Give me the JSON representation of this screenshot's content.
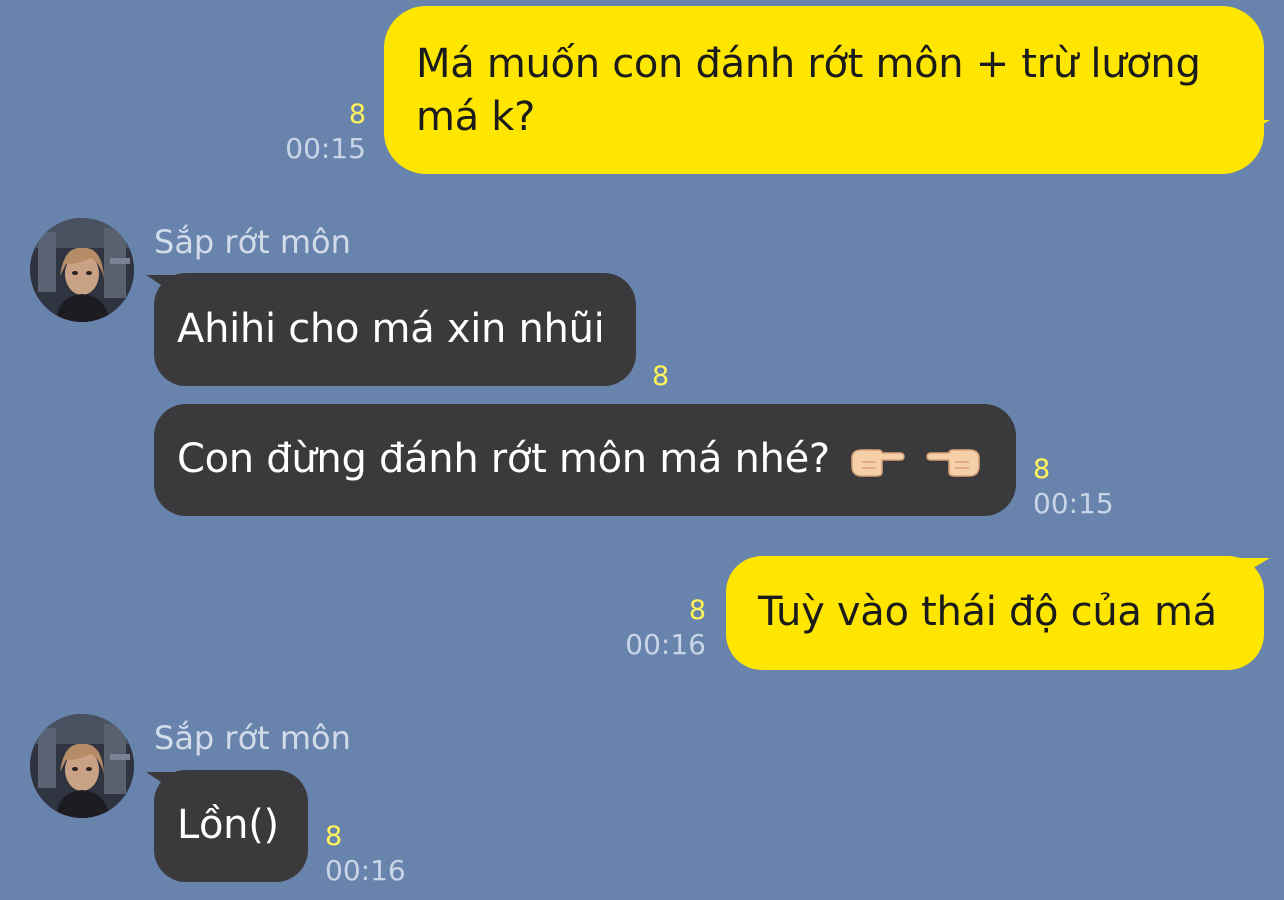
{
  "theme": {
    "background": "#6884ad",
    "sent_bubble": "#ffe600",
    "received_bubble": "#3a3a3d",
    "read_count_color": "#fff35a",
    "time_color": "#c9d4e6",
    "sender_color": "#d2dbea"
  },
  "messages": [
    {
      "direction": "sent",
      "text_line1": "Má muốn con đánh rớt môn + trừ lương",
      "text_line2": "má k?",
      "read_count": "8",
      "time": "00:15"
    },
    {
      "direction": "received",
      "sender": "Sắp rớt môn",
      "avatar_icon": "profile-photo-icon",
      "text": "Ahihi cho má xin nhũi",
      "read_count": "8"
    },
    {
      "direction": "received",
      "text": "Con đừng đánh rớt môn má nhé?",
      "emoji_icons": [
        "pointing-right-hand-icon",
        "pointing-left-hand-icon"
      ],
      "read_count": "8",
      "time": "00:15"
    },
    {
      "direction": "sent",
      "text": "Tuỳ vào thái độ của má",
      "read_count": "8",
      "time": "00:16"
    },
    {
      "direction": "received",
      "sender": "Sắp rớt môn",
      "avatar_icon": "profile-photo-icon",
      "text": "Lồn()",
      "read_count": "8",
      "time": "00:16"
    }
  ]
}
